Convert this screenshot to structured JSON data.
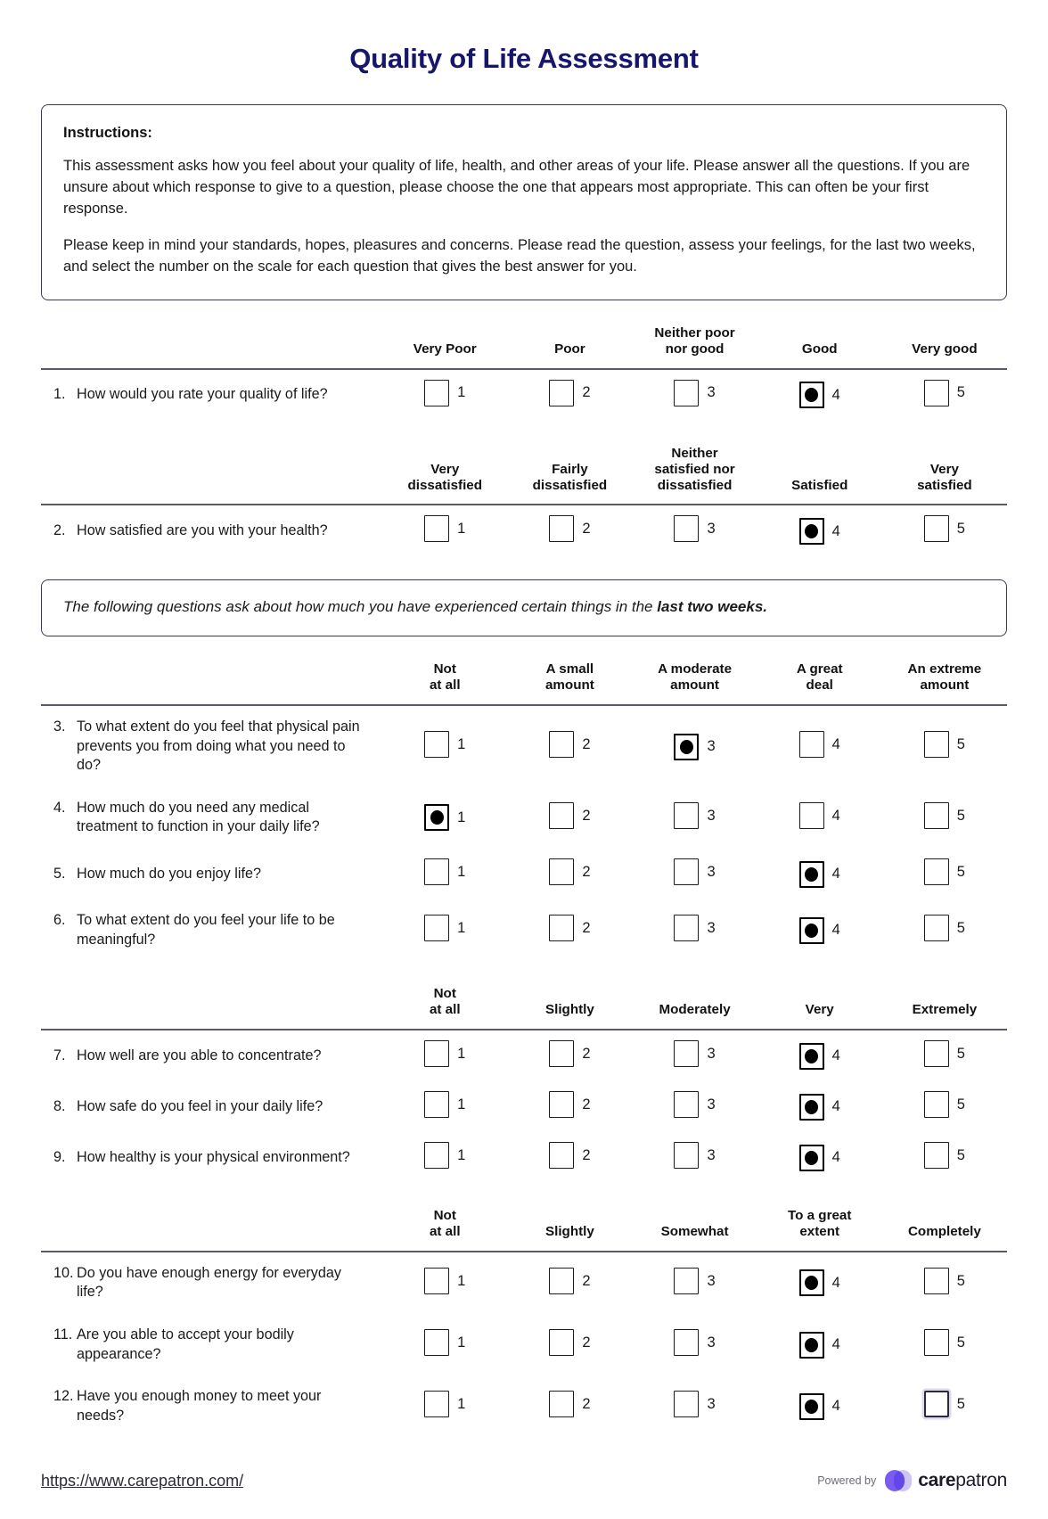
{
  "document": {
    "title": "Quality of Life Assessment",
    "title_color": "#16166b"
  },
  "instructions": {
    "heading": "Instructions:",
    "paragraph_1": "This assessment asks how you feel about your quality of life, health, and other areas of your life. Please answer all the questions. If you are unsure about which response to give to a question, please choose the one that appears most appropriate. This can often be your first response.",
    "paragraph_2": "Please keep in mind your standards, hopes, pleasures and concerns. Please read the question, assess your feelings, for the last two weeks, and select the number on the scale for each question that gives the best answer for you."
  },
  "note": {
    "text_plain": "The following questions ask about how much you have experienced certain things in the ",
    "text_bold": "last two weeks."
  },
  "sections": [
    {
      "id": "section-quality",
      "headers": [
        "Very Poor",
        "Poor",
        "Neither poor\nnor good",
        "Good",
        "Very good"
      ],
      "questions": [
        {
          "number": "1.",
          "text": "How would you rate your quality of life?",
          "options": [
            "1",
            "2",
            "3",
            "4",
            "5"
          ],
          "selected": 4
        }
      ]
    },
    {
      "id": "section-health",
      "headers": [
        "Very\ndissatisfied",
        "Fairly\ndissatisfied",
        "Neither\nsatisfied nor\ndissatisfied",
        "Satisfied",
        "Very\nsatisfied"
      ],
      "questions": [
        {
          "number": "2.",
          "text": "How satisfied are you with your health?",
          "options": [
            "1",
            "2",
            "3",
            "4",
            "5"
          ],
          "selected": 4
        }
      ]
    },
    {
      "id": "section-amount",
      "headers": [
        "Not\nat all",
        "A small\namount",
        "A moderate\namount",
        "A great\ndeal",
        "An extreme\namount"
      ],
      "questions": [
        {
          "number": "3.",
          "text": "To what extent do you feel that physical pain prevents you from doing what you need to do?",
          "options": [
            "1",
            "2",
            "3",
            "4",
            "5"
          ],
          "selected": 3
        },
        {
          "number": "4.",
          "text": "How much do you need any medical treatment to function in your daily life?",
          "options": [
            "1",
            "2",
            "3",
            "4",
            "5"
          ],
          "selected": 1
        },
        {
          "number": "5.",
          "text": "How much do you enjoy life?",
          "options": [
            "1",
            "2",
            "3",
            "4",
            "5"
          ],
          "selected": 4
        },
        {
          "number": "6.",
          "text": "To what extent do you feel your life to be meaningful?",
          "options": [
            "1",
            "2",
            "3",
            "4",
            "5"
          ],
          "selected": 4
        }
      ]
    },
    {
      "id": "section-degree",
      "headers": [
        "Not\nat all",
        "Slightly",
        "Moderately",
        "Very",
        "Extremely"
      ],
      "questions": [
        {
          "number": "7.",
          "text": "How well are you able to concentrate?",
          "options": [
            "1",
            "2",
            "3",
            "4",
            "5"
          ],
          "selected": 4
        },
        {
          "number": "8.",
          "text": "How safe do you feel in your daily life?",
          "options": [
            "1",
            "2",
            "3",
            "4",
            "5"
          ],
          "selected": 4
        },
        {
          "number": "9.",
          "text": "How healthy is your physical environment?",
          "options": [
            "1",
            "2",
            "3",
            "4",
            "5"
          ],
          "selected": 4
        }
      ]
    },
    {
      "id": "section-extent",
      "headers": [
        "Not\nat all",
        "Slightly",
        "Somewhat",
        "To a great\nextent",
        "Completely"
      ],
      "questions": [
        {
          "number": "10.",
          "text": "Do you have enough energy for everyday life?",
          "options": [
            "1",
            "2",
            "3",
            "4",
            "5"
          ],
          "selected": 4
        },
        {
          "number": "11.",
          "text": "Are you able to accept your bodily appearance?",
          "options": [
            "1",
            "2",
            "3",
            "4",
            "5"
          ],
          "selected": 4
        },
        {
          "number": "12.",
          "text": "Have you enough money to meet your needs?",
          "options": [
            "1",
            "2",
            "3",
            "4",
            "5"
          ],
          "selected": 4,
          "focused": 5
        }
      ]
    }
  ],
  "footer": {
    "url": "https://www.carepatron.com/",
    "powered_by_label": "Powered by",
    "brand_part_1": "care",
    "brand_part_2": "patron",
    "brand_color": "#7b5cf0"
  }
}
